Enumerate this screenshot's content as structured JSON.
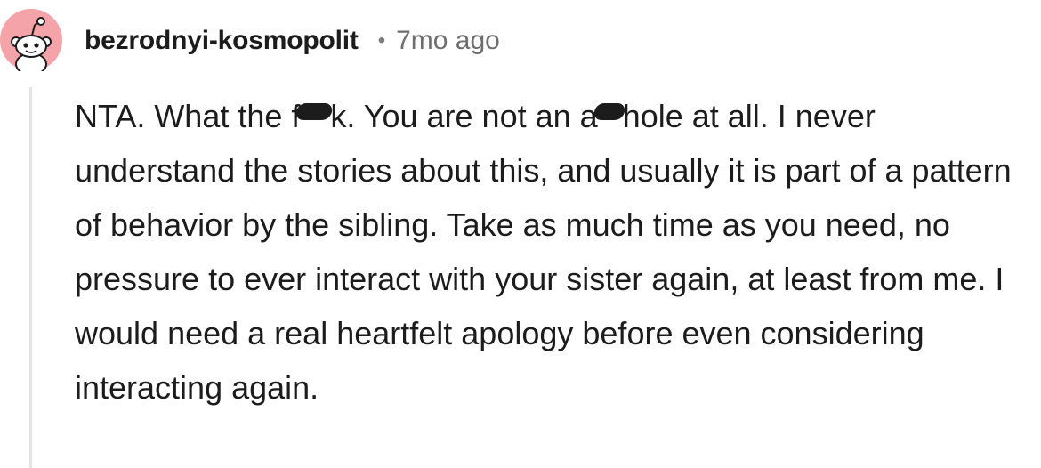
{
  "comment": {
    "author": "bezrodnyi-kosmopolit",
    "separator": "•",
    "age": "7mo ago",
    "avatar_icon": "reddit-snoo-icon",
    "colors": {
      "avatar_bg": "#f4a4a8",
      "text": "#1c1c1c",
      "meta": "#6e6e6e",
      "thread_line": "#e4e4e4"
    },
    "body": {
      "p1": "NTA. What the f",
      "p2": "k. You are not an a",
      "p3": "hole at all. I never understand the stories about this, and usually it is part of a pattern of behavior by the sibling. Take as much time as you need, no pressure to ever interact with your sister again, at least from me. I would need a real heartfelt apology before even considering interacting again."
    }
  }
}
